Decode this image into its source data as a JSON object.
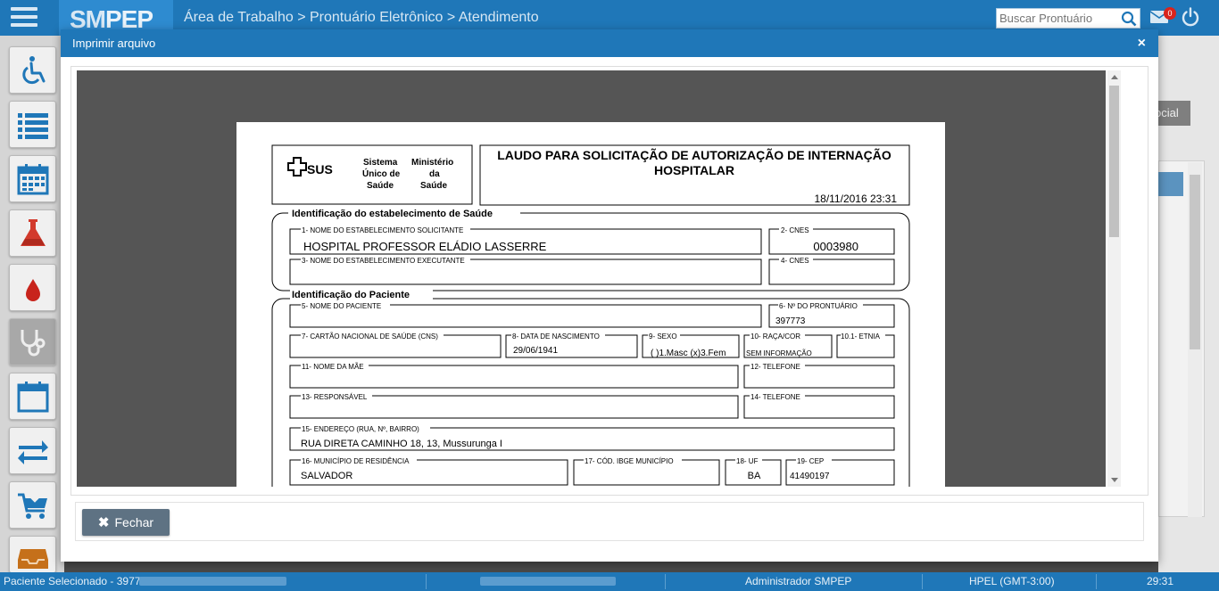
{
  "topbar": {
    "brand_sm": "SM",
    "brand_pep": "PEP",
    "breadcrumb": "Área de Trabalho > Prontuário Eletrônico > Atendimento",
    "search_placeholder": "Buscar Prontuário",
    "mail_badge": "0"
  },
  "sidebar": {
    "items": [
      "wheelchair-icon",
      "list-icon",
      "calendar-grid-icon",
      "flask-icon",
      "blood-drop-icon",
      "stethoscope-icon",
      "calendar-icon",
      "transfer-arrows-icon",
      "cart-download-icon",
      "inbox-icon"
    ]
  },
  "background": {
    "tab_label": "ocial"
  },
  "modal": {
    "title": "Imprimir arquivo",
    "close_label": "×",
    "fechar_label": "Fechar"
  },
  "document": {
    "logo_sus": "SUS",
    "logo_sistema_1": "Sistema",
    "logo_sistema_2": "Único de",
    "logo_sistema_3": "Saúde",
    "logo_min_1": "Ministério",
    "logo_min_2": "da",
    "logo_min_3": "Saúde",
    "title_line1": "LAUDO PARA SOLICITAÇÃO DE AUTORIZAÇÃO DE INTERNAÇÃO",
    "title_line2": "HOSPITALAR",
    "datetime": "18/11/2016 23:31",
    "section1": "Identificação do estabelecimento de Saúde",
    "f1_label": "1- NOME DO ESTABELECIMENTO SOLICITANTE",
    "f1_value": "HOSPITAL PROFESSOR ELÁDIO LASSERRE",
    "f2_label": "2- CNES",
    "f2_value": "0003980",
    "f3_label": "3- NOME DO ESTABELECIMENTO EXECUTANTE",
    "f4_label": "4- CNES",
    "section2": "Identificação do Paciente",
    "f5_label": "5- NOME DO PACIENTE",
    "f6_label": "6- Nº DO PRONTUÁRIO",
    "f6_value": "397773",
    "f7_label": "7- CARTÃO NACIONAL DE SAÚDE (CNS)",
    "f8_label": "8- DATA DE NASCIMENTO",
    "f8_value": "29/06/1941",
    "f9_label": "9- SEXO",
    "f9_value": "( )1.Masc  (x)3.Fem",
    "f10_label": "10- RAÇA/COR",
    "f10_value": "SEM INFORMAÇÃO",
    "f101_label": "10.1- ETNIA",
    "f11_label": "11- NOME DA MÃE",
    "f12_label": "12- TELEFONE",
    "f13_label": "13- RESPONSÁVEL",
    "f14_label": "14- TELEFONE",
    "f15_label": "15- ENDEREÇO (RUA, Nº, BAIRRO)",
    "f15_value": "RUA DIRETA CAMINHO 18, 13, Mussurunga I",
    "f16_label": "16- MUNICÍPIO DE RESIDÊNCIA",
    "f16_value": "SALVADOR",
    "f17_label": "17- CÓD. IBGE MUNICÍPIO",
    "f18_label": "18- UF",
    "f18_value": "BA",
    "f19_label": "19- CEP",
    "f19_value": "41490197"
  },
  "statusbar": {
    "patient": "Paciente Selecionado - 397773:",
    "user": "Administrador SMPEP",
    "timezone": "HPEL (GMT-3:00)",
    "clock": "29:31"
  },
  "colors": {
    "primary": "#1f77b8",
    "button": "#5e7283"
  }
}
